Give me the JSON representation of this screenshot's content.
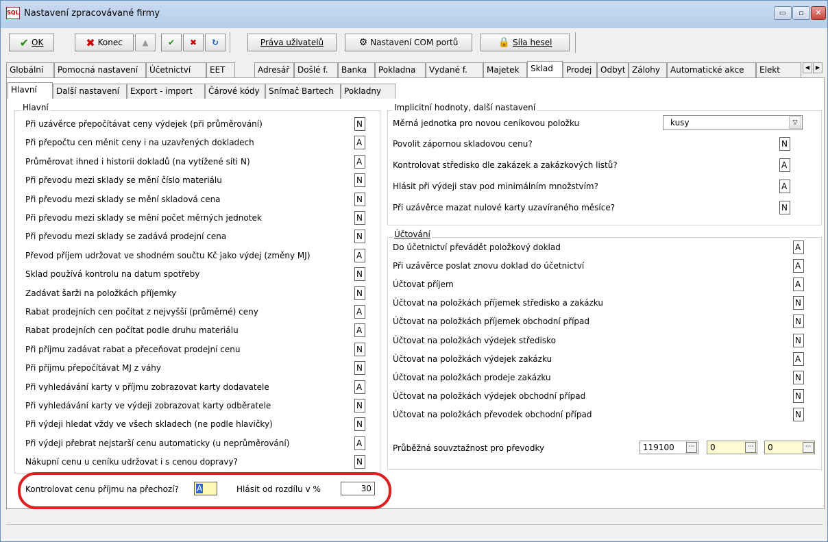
{
  "window": {
    "title": "Nastavení zpracovávané firmy",
    "app_icon_text": "SQL",
    "min_glyph": "▭",
    "max_glyph": "▫",
    "close_glyph": "✕"
  },
  "toolbar": {
    "ok_label": "OK",
    "konec_label": "Konec",
    "prava_label": "Práva uživatelů",
    "com_label": "Nastavení COM portů",
    "sila_label": "Síla hesel"
  },
  "tabs": [
    "Globální",
    "Pomocná nastavení",
    "Účetnictví",
    "EET",
    "Adresář",
    "Došlé f.",
    "Banka",
    "Pokladna",
    "Vydané f.",
    "Majetek",
    "Sklad",
    "Prodej",
    "Odbyt",
    "Zálohy",
    "Automatické akce",
    "Elekt"
  ],
  "subtabs": [
    "Hlavní",
    "Další nastavení",
    "Export - import",
    "Čárové kódy",
    "Snímač Bartech",
    "Pokladny"
  ],
  "left_group": {
    "title": "Hlavní",
    "rows": [
      {
        "label": "Při uzávěrce přepočítávat ceny výdejek (při průměrování)",
        "value": "N"
      },
      {
        "label": "Při přepočtu cen měnit ceny i na uzavřených dokladech",
        "value": "A"
      },
      {
        "label": "Průměrovat ihned i historii dokladů (na vytížené síti N)",
        "value": "A"
      },
      {
        "label": "Při převodu mezi sklady se mění číslo materiálu",
        "value": "N"
      },
      {
        "label": "Při převodu mezi sklady se mění skladová cena",
        "value": "N"
      },
      {
        "label": "Při převodu mezi sklady se mění počet měrných jednotek",
        "value": "N"
      },
      {
        "label": "Při převodu mezi sklady se zadává prodejní cena",
        "value": "N"
      },
      {
        "label": "Převod příjem udržovat ve shodném součtu Kč jako výdej (změny MJ)",
        "value": "A"
      },
      {
        "label": "Sklad používá kontrolu na datum spotřeby",
        "value": "N"
      },
      {
        "label": "Zadávat šarži na položkách příjemky",
        "value": "N"
      },
      {
        "label": "Rabat prodejních cen počítat z nejvyšší (průměrné) ceny",
        "value": "A"
      },
      {
        "label": "Rabat prodejních cen počítat podle druhu materiálu",
        "value": "A"
      },
      {
        "label": "Při příjmu zadávat rabat a přeceňovat prodejní cenu",
        "value": "N"
      },
      {
        "label": "Při příjmu přepočítávat MJ z váhy",
        "value": "N"
      },
      {
        "label": "Při vyhledávání karty v příjmu zobrazovat karty dodavatele",
        "value": "A"
      },
      {
        "label": "Při vyhledávání karty ve výdeji zobrazovat karty odběratele",
        "value": "N"
      },
      {
        "label": "Při výdeji hledat vždy ve všech skladech (ne podle hlavičky)",
        "value": "N"
      },
      {
        "label": "Při výdeji přebrat nejstarší cenu automaticky (u neprůměrování)",
        "value": "A"
      },
      {
        "label": "Nákupní cenu u ceníku udržovat i s cenou dopravy?",
        "value": "N"
      }
    ],
    "kontrolovat_label": "Kontrolovat cenu příjmu na přechozí?",
    "kontrolovat_value": "A",
    "hlasit_label": "Hlásit od rozdílu v %",
    "hlasit_value": "30"
  },
  "right_group1": {
    "title": "Implicitní hodnoty, další nastavení",
    "merna_label": "Měrná jednotka pro novou ceníkovou položku",
    "merna_value": "kusy",
    "rows": [
      {
        "label": "Povolit zápornou skladovou cenu?",
        "value": "N"
      },
      {
        "label": "Kontrolovat středisko dle zakázek a zakázkových listů?",
        "value": "A"
      },
      {
        "label": "Hlásit při výdeji stav pod minimálním množstvím?",
        "value": "A"
      },
      {
        "label": "Při uzávěrce mazat nulové karty uzavíraného měsíce?",
        "value": "N"
      }
    ]
  },
  "right_group2": {
    "title": "Účtování",
    "rows": [
      {
        "label": "Do účetnictví převádět položkový doklad",
        "value": "A"
      },
      {
        "label": "Při uzávěrce poslat znovu doklad do účetnictví",
        "value": "A"
      },
      {
        "label": "Účtovat příjem",
        "value": "A"
      },
      {
        "label": "Účtovat na položkách příjemek středisko a zakázku",
        "value": "N"
      },
      {
        "label": "Účtovat na položkách příjemek obchodní případ",
        "value": "N"
      },
      {
        "label": "Účtovat na položkách výdejek středisko",
        "value": "N"
      },
      {
        "label": "Účtovat na položkách výdejek zakázku",
        "value": "A"
      },
      {
        "label": "Účtovat na položkách prodeje zakázku",
        "value": "N"
      },
      {
        "label": "Účtovat na položkách výdejek obchodní případ",
        "value": "N"
      },
      {
        "label": "Účtovat na položkách převodek obchodní případ",
        "value": "N"
      }
    ],
    "prubezna_label": "Průběžná souvztažnost pro převodky",
    "prubezna_values": [
      "119100",
      "0",
      "0"
    ]
  }
}
